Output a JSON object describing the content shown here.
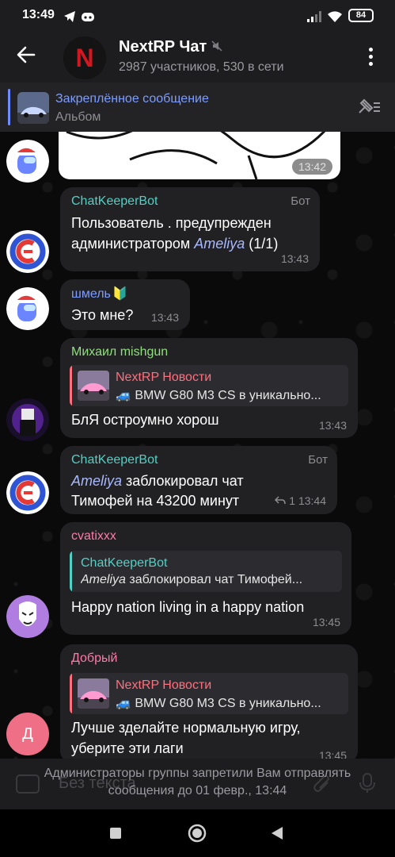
{
  "status_bar": {
    "time": "13:49",
    "battery": "84",
    "icons": [
      "telegram-icon",
      "discord-icon",
      "signal-icon",
      "wifi-icon",
      "battery-icon"
    ]
  },
  "header": {
    "title": "NextRP Чат",
    "subtitle": "2987 участников, 530 в сети",
    "avatar_letter": "N"
  },
  "pinned": {
    "title": "Закреплённое сообщение",
    "subtitle": "Альбом"
  },
  "messages": [
    {
      "time": "13:42"
    },
    {
      "sender": "ChatKeeperBot",
      "tag": "Бот",
      "line1": "Пользователь . предупрежден",
      "line2_prefix": "администратором ",
      "line2_name": "Ameliya",
      "line2_suffix": " (1/1)",
      "time": "13:43"
    },
    {
      "sender": "шмель",
      "badge": "🔰",
      "text": "Это мне?",
      "time": "13:43"
    },
    {
      "sender": "Михаил mishgun",
      "reply_name": "NextRP Новости",
      "reply_text": "🚙 BMW G80 M3 CS в уникально...",
      "text": "БлЯ остроумно хорош",
      "time": "13:43"
    },
    {
      "sender": "ChatKeeperBot",
      "tag": "Бот",
      "line1_name": "Ameliya",
      "line1_suffix": " заблокировал чат",
      "line2": "Тимофей на 43200 минут",
      "replies": "1",
      "time": "13:44"
    },
    {
      "sender": "cvatixxx",
      "reply_name": "ChatKeeperBot",
      "reply_name_italic": "Ameliya",
      "reply_text": " заблокировал чат  Тимофей...",
      "text": "Happy nation living in a happy nation",
      "time": "13:45"
    },
    {
      "sender": "Добрый",
      "avatar_letter": "Д",
      "reply_name": "NextRP Новости",
      "reply_text": "🚙 BMW G80 M3 CS в уникально...",
      "line1": "Лучше зделайте нормальную игру,",
      "line2": "уберите эти лаги",
      "time": "13:45"
    }
  ],
  "composer": {
    "ghost_placeholder": "Без текста",
    "restriction_line1": "Администраторы группы запретили Вам отправлять",
    "restriction_line2": "сообщения до 01 февр., 13:44"
  },
  "colors": {
    "bot_name": "#4fd1c5",
    "user_green": "#8fe07c",
    "user_pink": "#ff7aa8",
    "user_blue": "#7d9cff",
    "reply_news": "#ff6f7d",
    "avatar_pink": "#ef6f86"
  }
}
